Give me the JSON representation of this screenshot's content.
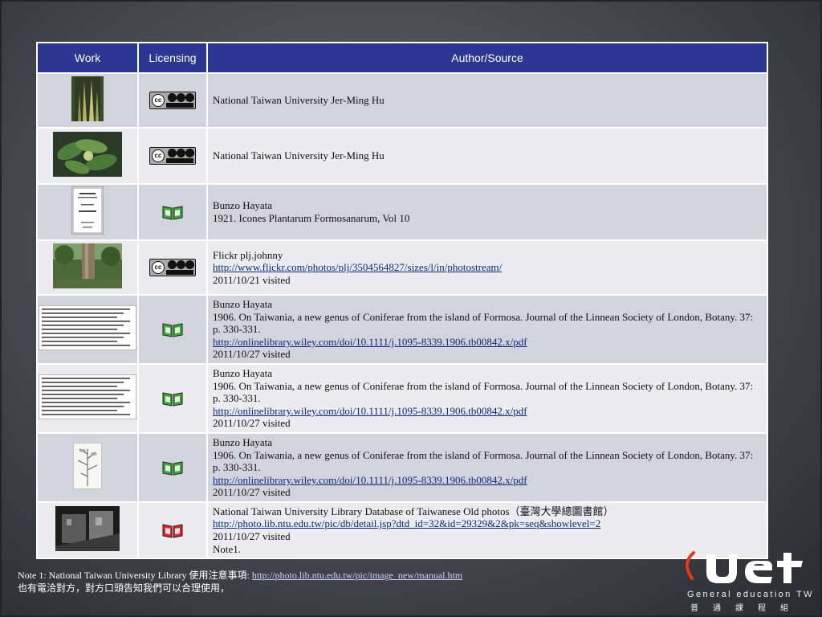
{
  "table": {
    "headers": {
      "work": "Work",
      "licensing": "Licensing",
      "source": "Author/Source"
    },
    "rows": [
      {
        "work_icon": "plant-spike-photo",
        "license_icon": "cc-by-nc-sa-icon",
        "lines": [
          "National Taiwan University Jer-Ming Hu"
        ]
      },
      {
        "work_icon": "leaf-cluster-photo",
        "license_icon": "cc-by-nc-sa-icon",
        "lines": [
          "National Taiwan University Jer-Ming Hu"
        ]
      },
      {
        "work_icon": "book-page-scan",
        "license_icon": "public-domain-book-icon",
        "lines": [
          "Bunzo Hayata",
          "1921. Icones Plantarum Formosanarum, Vol 10"
        ]
      },
      {
        "work_icon": "tree-trunk-photo",
        "license_icon": "cc-by-nc-sa-icon",
        "lines": [
          "Flickr plj.johnny"
        ],
        "link": "http://www.flickr.com/photos/plj/3504564827/sizes/l/in/photostream/",
        "visited": "2011/10/21 visited"
      },
      {
        "work_icon": "journal-text-scan",
        "license_icon": "public-domain-book-icon",
        "lines": [
          "Bunzo Hayata",
          "1906. On Taiwania, a new genus of Coniferae from the island of Formosa. Journal of the Linnean Society of London, Botany. 37: p. 330-331."
        ],
        "link": "http://onlinelibrary.wiley.com/doi/10.1111/j.1095-8339.1906.tb00842.x/pdf",
        "visited": "2011/10/27 visited"
      },
      {
        "work_icon": "journal-text-scan",
        "license_icon": "public-domain-book-icon",
        "lines": [
          "Bunzo Hayata",
          "1906. On Taiwania, a new genus of Coniferae from the island of Formosa. Journal of the Linnean Society of London, Botany. 37: p. 330-331."
        ],
        "link": "http://onlinelibrary.wiley.com/doi/10.1111/j.1095-8339.1906.tb00842.x/pdf",
        "visited": "2011/10/27 visited"
      },
      {
        "work_icon": "botanical-drawing-scan",
        "license_icon": "public-domain-book-icon",
        "lines": [
          "Bunzo Hayata",
          "1906. On Taiwania, a new genus of Coniferae from the island of Formosa. Journal of the Linnean Society of London, Botany. 37: p. 330-331."
        ],
        "link": "http://onlinelibrary.wiley.com/doi/10.1111/j.1095-8339.1906.tb00842.x/pdf",
        "visited": "2011/10/27 visited"
      },
      {
        "work_icon": "old-photo-bw",
        "license_icon": "restricted-book-icon",
        "lines": [
          "National Taiwan University Library Database of Taiwanese Old photos（臺灣大學總圖書館）"
        ],
        "link": "http://photo.lib.ntu.edu.tw/pic/db/detail.jsp?dtd_id=32&id=29329&2&pk=seq&showlevel=2",
        "visited": "2011/10/27 visited",
        "extra": "Note1."
      }
    ]
  },
  "note": {
    "line1_prefix": "Note 1: National Taiwan University Library 使用注意事項:",
    "link": "http://photo.lib.ntu.edu.tw/pic/image_new/manual.htm",
    "line2": "也有電洽對方，對方口頭告知我們可以合理使用，"
  },
  "logo": {
    "mark": "UEt",
    "tagline": "General education TW",
    "cn": "普通課程組"
  },
  "colors": {
    "header_bg": "#2b3791",
    "row_odd": "#d3d3de",
    "row_even": "#ebebf0",
    "book_green": "#3aa63a",
    "book_red": "#d8262c",
    "logo_red": "#e23a1a"
  }
}
